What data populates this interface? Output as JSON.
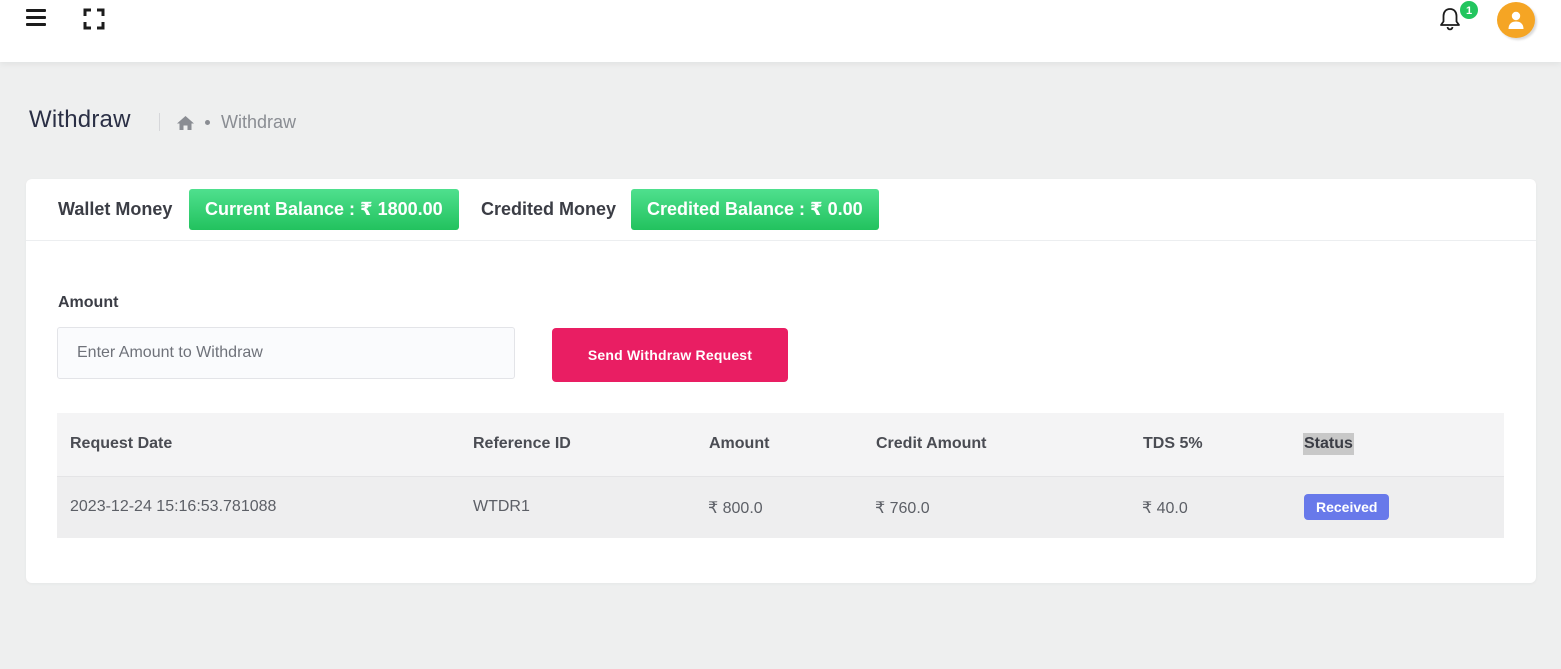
{
  "header": {
    "menu_icon": "hamburger-menu-icon",
    "fullscreen_icon": "fullscreen-icon",
    "bell_icon": "bell-icon",
    "notification_count": "1",
    "avatar_icon": "user-avatar-icon"
  },
  "page": {
    "title": "Withdraw",
    "breadcrumb": {
      "home_icon": "home-icon",
      "current": "Withdraw"
    }
  },
  "wallet": {
    "wallet_label": "Wallet Money",
    "current_balance": "Current Balance : ₹ 1800.00",
    "credited_label": "Credited Money",
    "credited_balance": "Credited Balance : ₹ 0.00"
  },
  "form": {
    "amount_label": "Amount",
    "amount_placeholder": "Enter Amount to Withdraw",
    "amount_value": "",
    "submit_label": "Send Withdraw Request"
  },
  "table": {
    "headers": [
      "Request Date",
      "Reference ID",
      "Amount",
      "Credit Amount",
      "TDS 5%",
      "Status"
    ],
    "rows": [
      {
        "request_date": "2023-12-24 15:16:53.781088",
        "reference_id": "WTDR1",
        "amount": "₹ 800.0",
        "credit_amount": "₹ 760.0",
        "tds": "₹ 40.0",
        "status": "Received"
      }
    ]
  },
  "colors": {
    "primary_pink": "#e91e63",
    "balance_green": "#22c25e",
    "status_blue": "#6879ea",
    "notification_green": "#22c55e",
    "avatar_orange": "#f5a524"
  }
}
